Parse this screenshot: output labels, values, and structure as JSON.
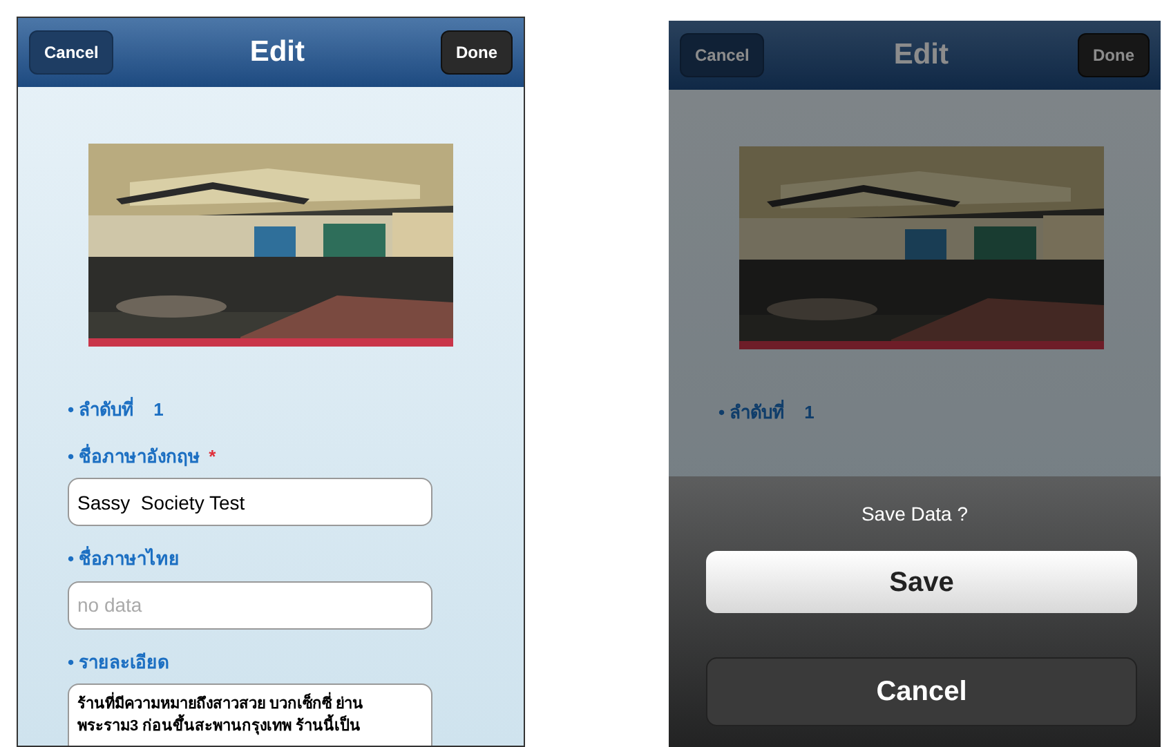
{
  "screens": [
    {
      "dimmed": false,
      "nav": {
        "left_button": "Cancel",
        "title": "Edit",
        "right_button": "Done"
      },
      "photo": {
        "kind": "picture"
      },
      "fields": [
        {
          "kind": "info",
          "label": "• ลำดับที่",
          "value": "1"
        },
        {
          "kind": "input",
          "label": "• ชื่อภาษาอังกฤษ",
          "required_mark": "*",
          "value": "Sassy  Society Test"
        },
        {
          "kind": "input",
          "label": "• ชื่อภาษาไทย",
          "placeholder": "no data"
        },
        {
          "kind": "textarea",
          "label": "• รายละเอียด",
          "value": "ร้านที่มีความหมายถึงสาวสวย บวกเซ็กซี่ ย่าน พระราม3  ก่อนขึ้นสะพานกรุงเทพ ร้านนี้เป็น"
        }
      ]
    },
    {
      "dimmed": true,
      "nav": {
        "left_button": "Cancel",
        "title": "Edit",
        "right_button": "Done"
      },
      "photo": {
        "kind": "picture"
      },
      "fields": [
        {
          "kind": "info",
          "label": "• ลำดับที่",
          "value": "1"
        }
      ],
      "action_sheet": {
        "title": "Save Data ?",
        "buttons": [
          {
            "kind": "primary",
            "label": "Save"
          },
          {
            "kind": "cancel",
            "label": "Cancel"
          }
        ]
      }
    }
  ]
}
